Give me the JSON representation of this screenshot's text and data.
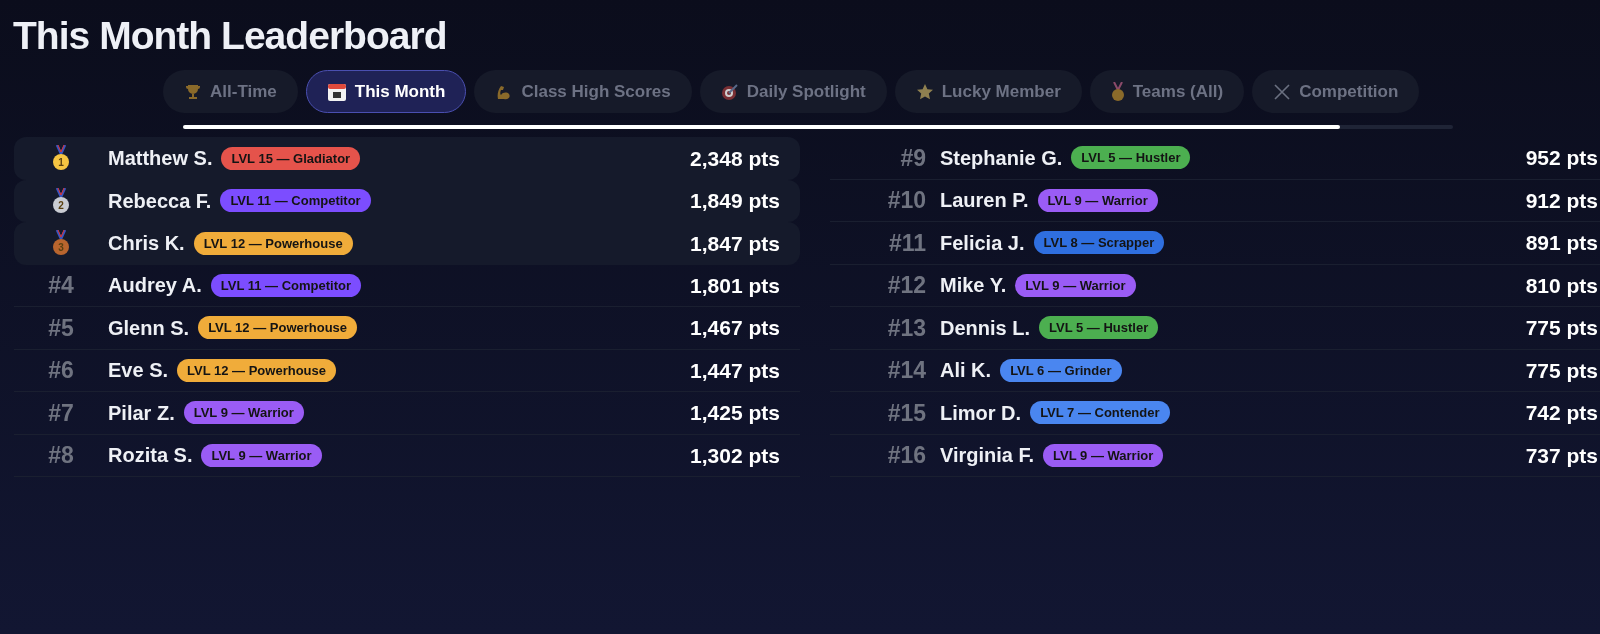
{
  "title": "This Month Leaderboard",
  "tabs": [
    {
      "label": "All-Time",
      "selected": false
    },
    {
      "label": "This Month",
      "selected": true
    },
    {
      "label": "Class High Scores",
      "selected": false
    },
    {
      "label": "Daily Spotlight",
      "selected": false
    },
    {
      "label": "Lucky Member",
      "selected": false
    },
    {
      "label": "Teams (All)",
      "selected": false
    },
    {
      "label": "Competition",
      "selected": false
    }
  ],
  "columns": [
    [
      {
        "kind": "gold",
        "rank": "1",
        "name": "Matthew S.",
        "badge": {
          "text": "LVL 15 — Gladiator",
          "color": "#e5534b"
        },
        "points": "2,348 pts"
      },
      {
        "kind": "silver",
        "rank": "2",
        "name": "Rebecca F.",
        "badge": {
          "text": "LVL 11 — Competitor",
          "color": "#7c4dff"
        },
        "points": "1,849 pts"
      },
      {
        "kind": "bronze",
        "rank": "3",
        "name": "Chris K.",
        "badge": {
          "text": "LVL 12 — Powerhouse",
          "color": "#f0ac3a"
        },
        "points": "1,847 pts"
      },
      {
        "kind": "number",
        "rank": "#4",
        "name": "Audrey A.",
        "badge": {
          "text": "LVL 11 — Competitor",
          "color": "#7c4dff"
        },
        "points": "1,801 pts"
      },
      {
        "kind": "number",
        "rank": "#5",
        "name": "Glenn S.",
        "badge": {
          "text": "LVL 12 — Powerhouse",
          "color": "#f0ac3a"
        },
        "points": "1,467 pts"
      },
      {
        "kind": "number",
        "rank": "#6",
        "name": "Eve S.",
        "badge": {
          "text": "LVL 12 — Powerhouse",
          "color": "#f0ac3a"
        },
        "points": "1,447 pts"
      },
      {
        "kind": "number",
        "rank": "#7",
        "name": "Pilar Z.",
        "badge": {
          "text": "LVL 9 — Warrior",
          "color": "#9a5cf5"
        },
        "points": "1,425 pts"
      },
      {
        "kind": "number",
        "rank": "#8",
        "name": "Rozita S.",
        "badge": {
          "text": "LVL 9 — Warrior",
          "color": "#9a5cf5"
        },
        "points": "1,302 pts"
      }
    ],
    [
      {
        "kind": "number",
        "rank": "#9",
        "name": "Stephanie G.",
        "badge": {
          "text": "LVL 5 — Hustler",
          "color": "#4caf50"
        },
        "points": "952 pts"
      },
      {
        "kind": "number",
        "rank": "#10",
        "name": "Lauren P.",
        "badge": {
          "text": "LVL 9 — Warrior",
          "color": "#9a5cf5"
        },
        "points": "912 pts"
      },
      {
        "kind": "number",
        "rank": "#11",
        "name": "Felicia J.",
        "badge": {
          "text": "LVL 8 — Scrapper",
          "color": "#2f6fe0"
        },
        "points": "891 pts"
      },
      {
        "kind": "number",
        "rank": "#12",
        "name": "Mike Y.",
        "badge": {
          "text": "LVL 9 — Warrior",
          "color": "#9a5cf5"
        },
        "points": "810 pts"
      },
      {
        "kind": "number",
        "rank": "#13",
        "name": "Dennis L.",
        "badge": {
          "text": "LVL 5 — Hustler",
          "color": "#4caf50"
        },
        "points": "775 pts"
      },
      {
        "kind": "number",
        "rank": "#14",
        "name": "Ali K.",
        "badge": {
          "text": "LVL 6 — Grinder",
          "color": "#4a86f0"
        },
        "points": "775 pts"
      },
      {
        "kind": "number",
        "rank": "#15",
        "name": "Limor D.",
        "badge": {
          "text": "LVL 7 — Contender",
          "color": "#4a86f0"
        },
        "points": "742 pts"
      },
      {
        "kind": "number",
        "rank": "#16",
        "name": "Virginia F.",
        "badge": {
          "text": "LVL 9 — Warrior",
          "color": "#9a5cf5"
        },
        "points": "737 pts"
      }
    ]
  ]
}
